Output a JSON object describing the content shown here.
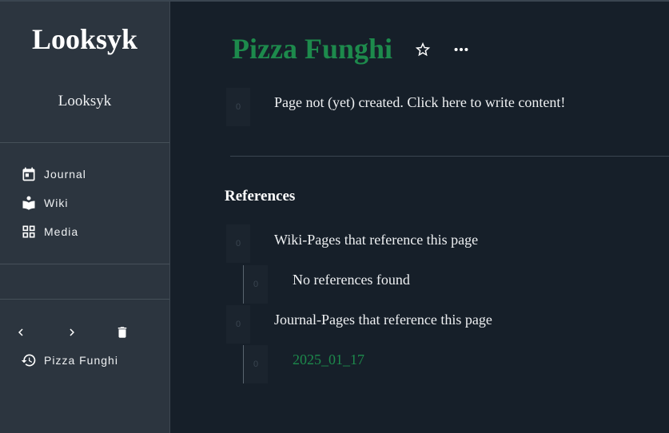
{
  "sidebar": {
    "brand": "Looksyk",
    "subtitle": "Looksyk",
    "nav": [
      {
        "label": "Journal",
        "icon": "calendar-icon"
      },
      {
        "label": "Wiki",
        "icon": "book-reader-icon"
      },
      {
        "label": "Media",
        "icon": "grid-icon"
      }
    ],
    "history": {
      "back_icon": "chevron-left-icon",
      "forward_icon": "chevron-right-icon",
      "delete_icon": "trash-icon",
      "item_label": "Pizza Funghi",
      "item_icon": "history-icon"
    }
  },
  "page": {
    "title": "Pizza Funghi",
    "favorite_icon": "star-outline-icon",
    "more_icon": "more-horizontal-icon",
    "placeholder_text": "Page not (yet) created. Click here to write content!",
    "block_handle_label": "0"
  },
  "references": {
    "heading": "References",
    "wiki_label": "Wiki-Pages that reference this page",
    "wiki_empty": "No references found",
    "journal_label": "Journal-Pages that reference this page",
    "journal_link": "2025_01_17"
  },
  "colors": {
    "accent": "#1d8a4c",
    "sidebar_bg": "#2c353f",
    "main_bg": "#161f29"
  }
}
